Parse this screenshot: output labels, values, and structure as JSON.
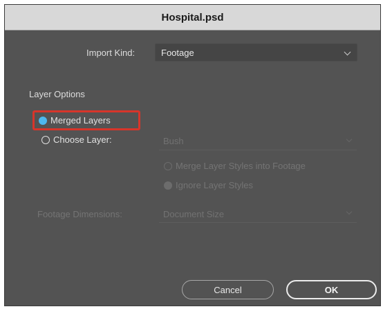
{
  "window": {
    "title": "Hospital.psd"
  },
  "import_kind": {
    "label": "Import Kind:",
    "value": "Footage"
  },
  "layer_options": {
    "title": "Layer Options",
    "merged_layers_label": "Merged Layers",
    "choose_layer_label": "Choose Layer:",
    "selected_option": "Merged Layers",
    "layer_select_value": "Bush",
    "merge_styles_label": "Merge Layer Styles into Footage",
    "ignore_styles_label": "Ignore Layer Styles"
  },
  "footage_dimensions": {
    "label": "Footage Dimensions:",
    "value": "Document Size"
  },
  "buttons": {
    "cancel": "Cancel",
    "ok": "OK"
  },
  "colors": {
    "dialog_bg": "#535353",
    "radio_selected": "#4db8ef",
    "highlight_box": "#d8352a"
  },
  "icons": [
    "chevron-down-icon",
    "radio-selected-icon",
    "radio-unselected-icon"
  ]
}
